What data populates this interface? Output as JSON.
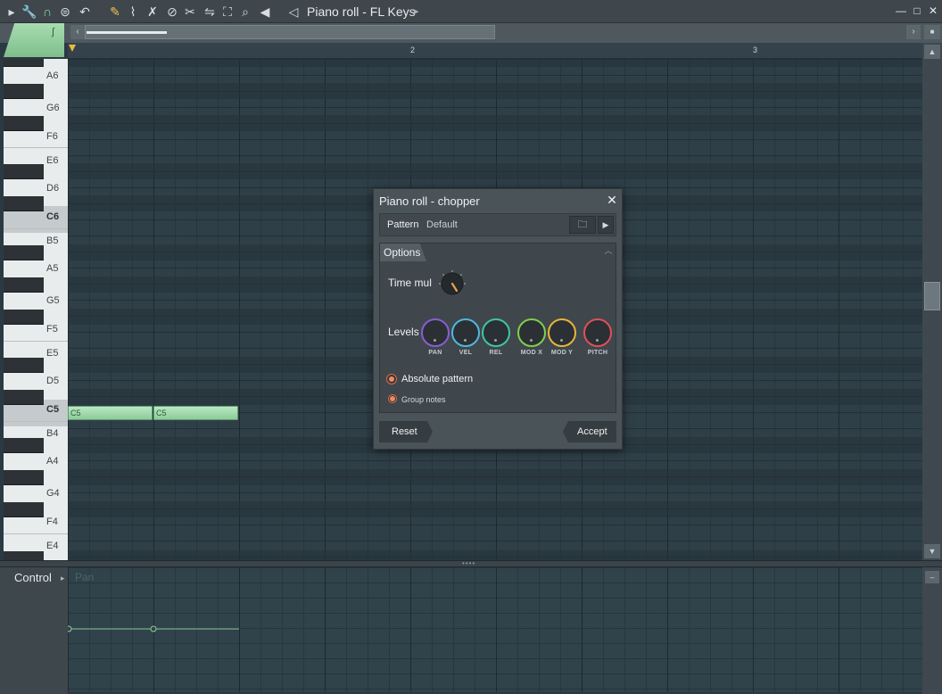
{
  "titlebar": {
    "title": "Piano roll - FL Keys",
    "tools": [
      {
        "icon": "play-arrow-icon",
        "glyph": "▸"
      },
      {
        "icon": "wrench-icon",
        "glyph": "🔧"
      },
      {
        "icon": "magnet-icon",
        "glyph": "∩"
      },
      {
        "icon": "menu-circle-icon",
        "glyph": "⊜"
      },
      {
        "icon": "undo-icon",
        "glyph": "↶"
      },
      {
        "icon": "pencil-icon",
        "glyph": "✎"
      },
      {
        "icon": "paint-brush-icon",
        "glyph": "⌇"
      },
      {
        "icon": "delete-tool-icon",
        "glyph": "✗"
      },
      {
        "icon": "mute-tool-icon",
        "glyph": "⊘"
      },
      {
        "icon": "slice-tool-icon",
        "glyph": "✂"
      },
      {
        "icon": "slip-tool-icon",
        "glyph": "⇋"
      },
      {
        "icon": "select-tool-icon",
        "glyph": "⛶"
      },
      {
        "icon": "zoom-icon",
        "glyph": "⌕"
      },
      {
        "icon": "playback-tool-icon",
        "glyph": "◀"
      },
      {
        "icon": "speaker-icon",
        "glyph": "◁"
      }
    ]
  },
  "timeline": {
    "bars": [
      "2",
      "3"
    ]
  },
  "piano": {
    "labels": [
      "A6",
      "G6",
      "F6",
      "E6",
      "D6",
      "C6",
      "B5",
      "A5",
      "G5",
      "F5",
      "E5",
      "D5",
      "C5",
      "B4",
      "A4",
      "G4",
      "F4",
      "E4"
    ]
  },
  "notes": [
    {
      "label": "C5",
      "pitch": "C5",
      "start_beat": 0,
      "length_beats": 1
    },
    {
      "label": "C5",
      "pitch": "C5",
      "start_beat": 1,
      "length_beats": 1
    }
  ],
  "control": {
    "label": "Control",
    "target": "Pan"
  },
  "dialog": {
    "title": "Piano roll - chopper",
    "pattern_label": "Pattern",
    "pattern_value": "Default",
    "options_label": "Options",
    "time_mul_label": "Time mul",
    "levels_label": "Levels",
    "levels": [
      {
        "label": "PAN",
        "color": "#8c5bd8"
      },
      {
        "label": "VEL",
        "color": "#4fb8e0"
      },
      {
        "label": "REL",
        "color": "#3fc6a0"
      },
      {
        "label": "MOD X",
        "color": "#7ed04a"
      },
      {
        "label": "MOD Y",
        "color": "#e8b43c"
      },
      {
        "label": "PITCH",
        "color": "#e0505a"
      }
    ],
    "absolute_pattern_label": "Absolute pattern",
    "group_notes_label": "Group notes",
    "reset_label": "Reset",
    "accept_label": "Accept"
  },
  "colors": {
    "note_fill": "#9fd8ab",
    "accent_orange": "#f08a62"
  }
}
